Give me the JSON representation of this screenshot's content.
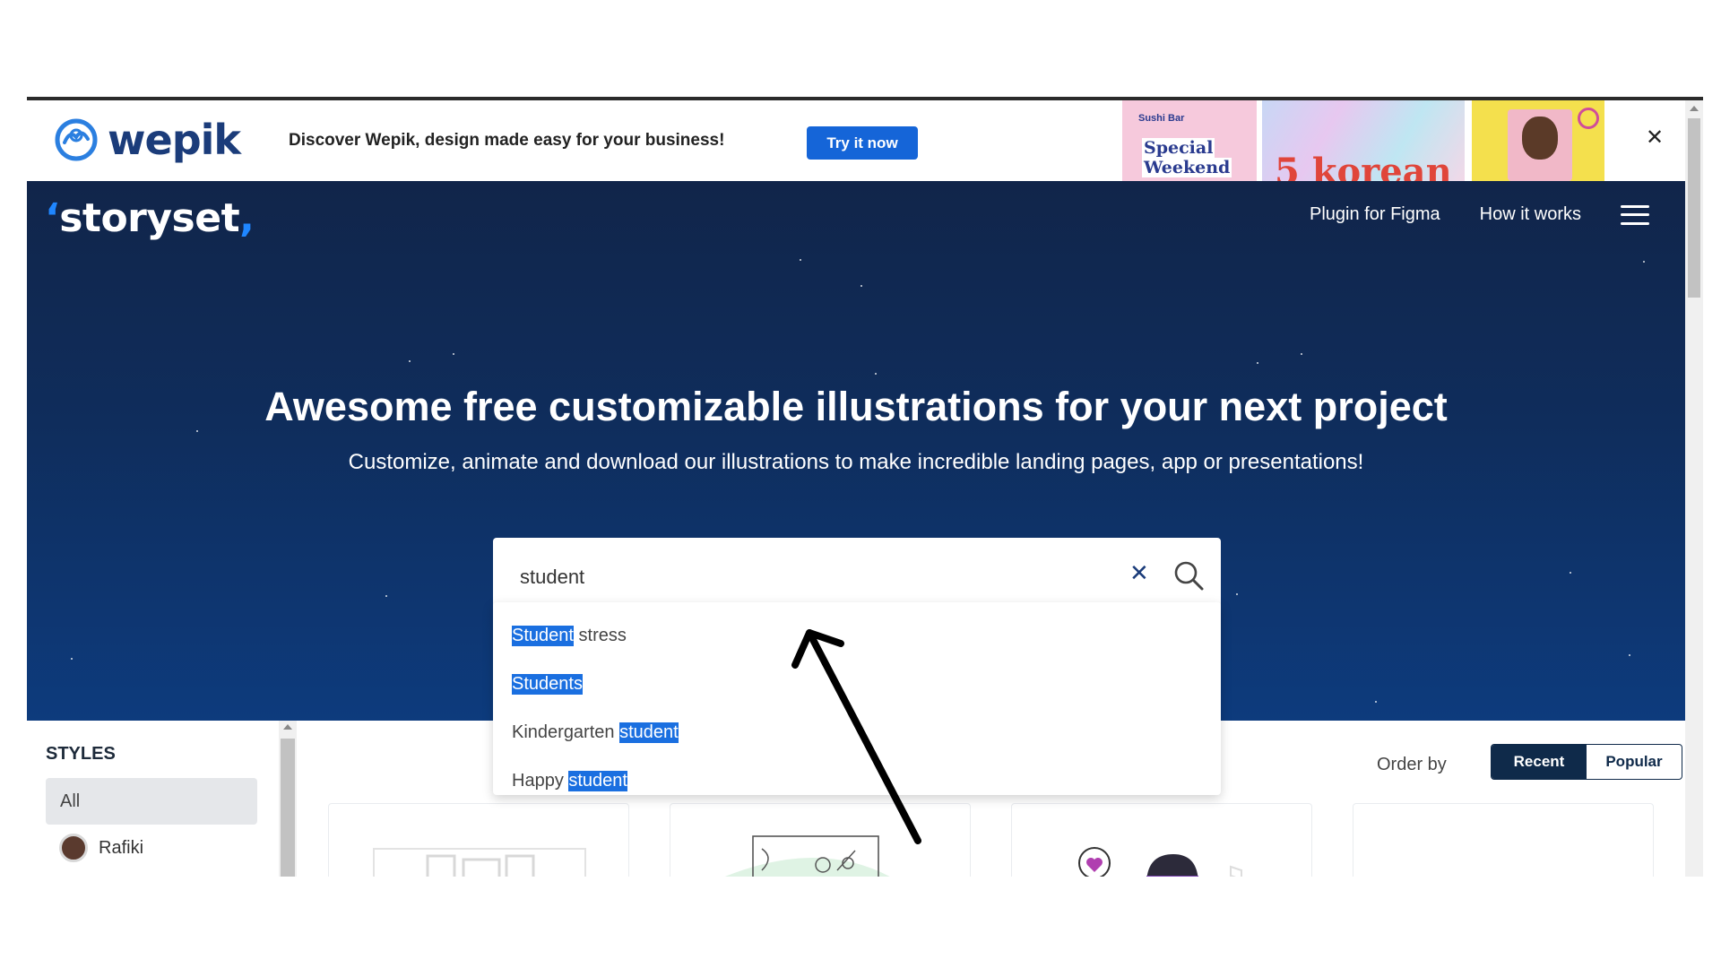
{
  "banner": {
    "brand": "wepik",
    "message": "Discover Wepik, design made easy for your business!",
    "cta_label": "Try it now",
    "art_texts": [
      "Sushi Bar",
      "Special",
      "Weekend",
      "5 korean"
    ]
  },
  "header": {
    "brand": "storyset",
    "nav": {
      "plugin_label": "Plugin for Figma",
      "how_label": "How it works"
    }
  },
  "hero": {
    "title": "Awesome free customizable illustrations for your next project",
    "subtitle": "Customize, animate and download our illustrations to make incredible landing pages, app or presentations!"
  },
  "search": {
    "value": "student",
    "suggestions": [
      {
        "match": "Student",
        "rest": " stress"
      },
      {
        "match": "Students",
        "rest": ""
      },
      {
        "prefix": "Kindergarten ",
        "match": "student"
      },
      {
        "prefix": "Happy ",
        "match": "student"
      }
    ]
  },
  "sidebar": {
    "title": "STYLES",
    "items": [
      {
        "label": "All"
      },
      {
        "label": "Rafiki"
      }
    ]
  },
  "order": {
    "label": "Order by",
    "options": [
      "Recent",
      "Popular"
    ],
    "selected": "Recent"
  },
  "colors": {
    "hero_top": "#11254a",
    "hero_bottom": "#0d3b7d",
    "accent_blue": "#1565d8",
    "highlight": "#1a6fe0",
    "toggle_dark": "#0f2a4a"
  },
  "icons": [
    "wepik-logo-icon",
    "close-icon",
    "menu-icon",
    "clear-icon",
    "search-icon"
  ]
}
